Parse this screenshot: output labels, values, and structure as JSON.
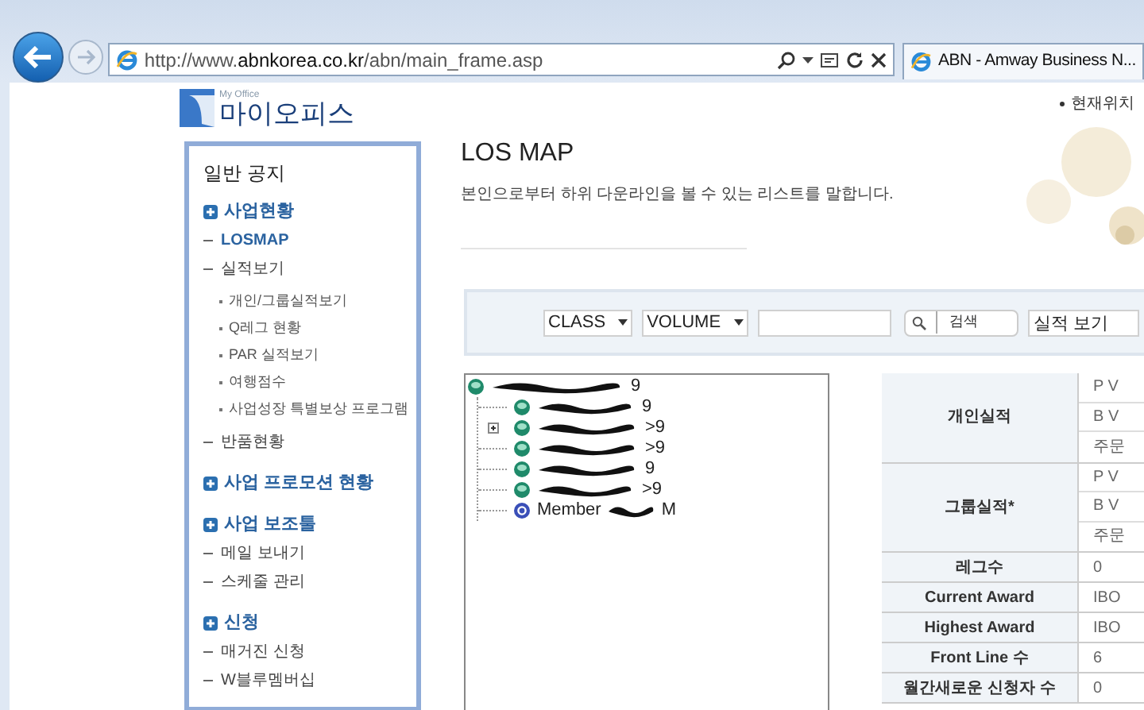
{
  "browser": {
    "url_prefix": "http://www.",
    "url_host": "abnkorea.co.kr",
    "url_path": "/abn/main_frame.asp",
    "tab_title": "ABN - Amway Business N..."
  },
  "header": {
    "logo_small": "My Office",
    "logo_text": "마이오피스",
    "location": "현재위치"
  },
  "sidebar": {
    "title": "일반 공지",
    "sections": [
      {
        "label": "사업현황",
        "children": [
          {
            "label": "LOSMAP",
            "selected": true
          },
          {
            "label": "실적보기",
            "selected": false,
            "children": [
              {
                "label": "개인/그룹실적보기",
                "selected": false
              },
              {
                "label": "Q레그 현황",
                "selected": false
              },
              {
                "label": "PAR 실적보기",
                "selected": false
              },
              {
                "label": "여행점수",
                "selected": false
              },
              {
                "label": "사업성장 특별보상 프로그램",
                "selected": false
              }
            ]
          },
          {
            "label": "반품현황",
            "selected": false
          }
        ]
      },
      {
        "label": "사업 프로모션 현황"
      },
      {
        "label": "사업 보조툴",
        "children": [
          {
            "label": "메일 보내기",
            "selected": false
          },
          {
            "label": "스케줄 관리",
            "selected": false
          }
        ]
      },
      {
        "label": "신청",
        "children": [
          {
            "label": "매거진 신청",
            "selected": false
          },
          {
            "label": "W블루멤버십",
            "selected": false
          }
        ]
      }
    ]
  },
  "page": {
    "title": "LOS MAP",
    "subtitle": "본인으로부터 하위 다운라인을 볼 수 있는 리스트를 말합니다."
  },
  "toolbar": {
    "selects": [
      "CLASS",
      "VOLUME"
    ],
    "search_button": "검색",
    "view_select": "실적 보기"
  },
  "tree": {
    "root": {
      "kind": "group",
      "redacted": true,
      "suffix": "9",
      "children": [
        {
          "kind": "group",
          "redacted": true,
          "suffix": "9",
          "expandable": false
        },
        {
          "kind": "group",
          "redacted": true,
          "suffix": ">9",
          "expandable": true
        },
        {
          "kind": "group",
          "redacted": true,
          "suffix": ">9",
          "expandable": false
        },
        {
          "kind": "group",
          "redacted": true,
          "suffix": "9",
          "expandable": false
        },
        {
          "kind": "group",
          "redacted": true,
          "suffix": ">9",
          "expandable": false
        },
        {
          "kind": "member",
          "redacted": true,
          "label": "Member",
          "suffix": "M",
          "expandable": false
        }
      ]
    }
  },
  "table": {
    "groups": [
      {
        "label": "개인실적",
        "rows": [
          {
            "label": "P V",
            "value": ""
          },
          {
            "label": "B V",
            "value": ""
          },
          {
            "label": "주문",
            "value": ""
          }
        ]
      },
      {
        "label": "그룹실적*",
        "rows": [
          {
            "label": "P V",
            "value": ""
          },
          {
            "label": "B V",
            "value": ""
          },
          {
            "label": "주문",
            "value": ""
          }
        ]
      }
    ],
    "rows": [
      {
        "label": "레그수",
        "value": "0"
      },
      {
        "label": "Current Award",
        "value": "IBO"
      },
      {
        "label": "Highest Award",
        "value": "IBO"
      },
      {
        "label": "Front Line 수",
        "value": "6"
      },
      {
        "label": "월간새로운 신청자 수",
        "value": "0"
      }
    ]
  }
}
